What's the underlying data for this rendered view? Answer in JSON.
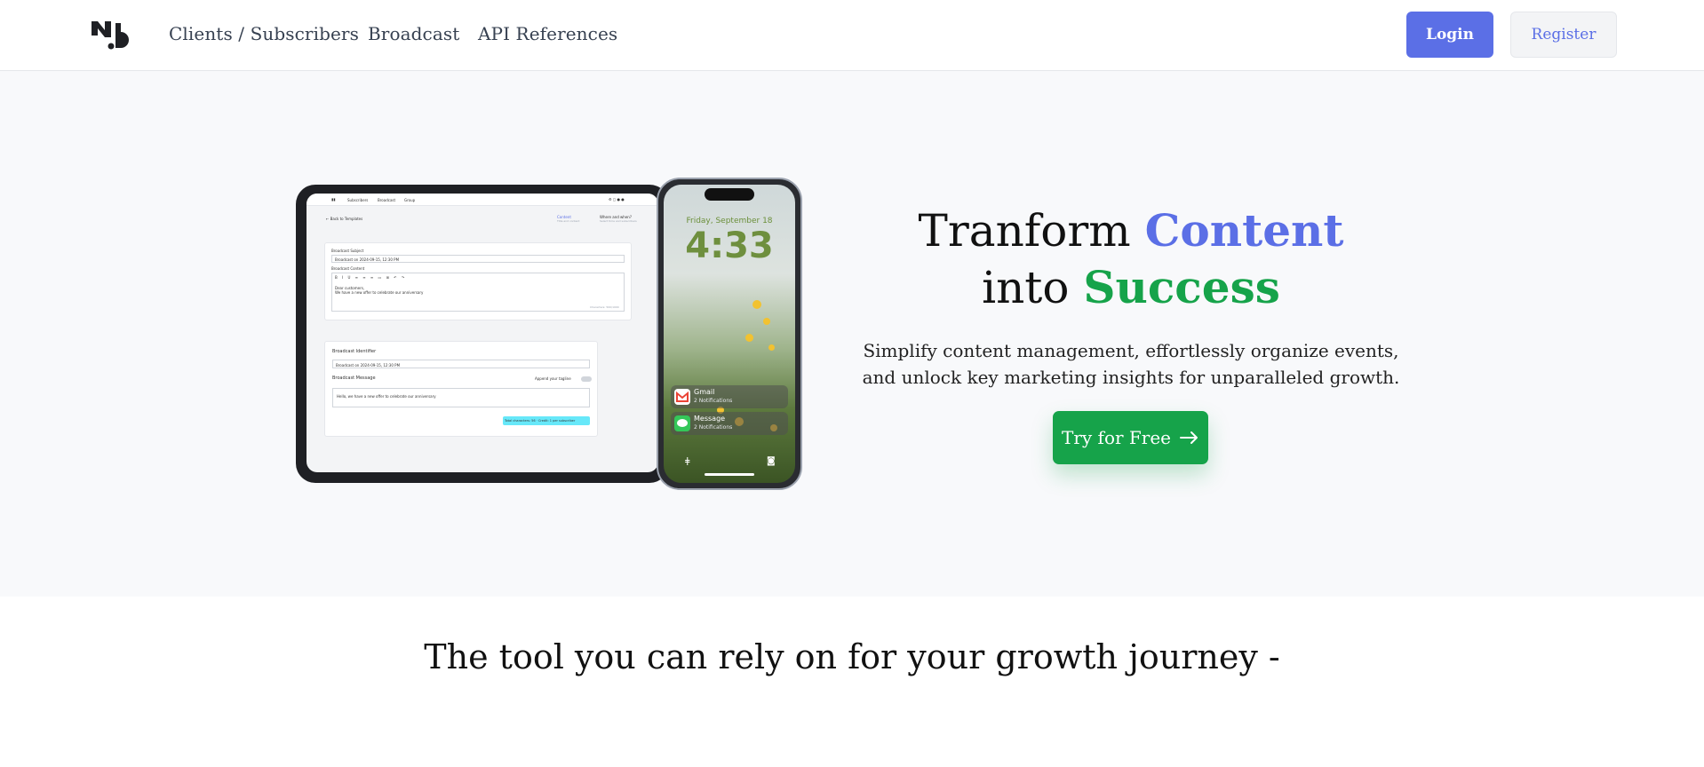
{
  "header": {
    "nav": [
      "Clients / Subscribers",
      "Broadcast",
      "API References"
    ],
    "login_label": "Login",
    "register_label": "Register"
  },
  "hero": {
    "headline_part1": "Tranform ",
    "headline_word1": "Content",
    "headline_part2": "into ",
    "headline_word2": "Success",
    "subtext_line1": "Simplify content management, effortlessly organize events,",
    "subtext_line2": "and unlock key marketing insights for unparalleled growth.",
    "cta_label": "Try for Free",
    "cta_icon": "arrow-right-icon"
  },
  "tablet": {
    "nav": [
      "Subscribers",
      "Broadcast",
      "Group"
    ],
    "back_link": "← Back to Templates",
    "step1": "Content",
    "step1_sub": "Title and content",
    "step2": "Where and when?",
    "step2_sub": "Select time and subscribers",
    "field1_label": "Broadcast Subject",
    "field1_value": "Broadcast on 2024-09-15, 12:30 PM",
    "field2_label": "Broadcast Content",
    "editor_text1": "Dear customers,",
    "editor_text2": "We have a new offer to celebrate our anniversary",
    "counter": "Characters: 500/1000",
    "card2_title": "Broadcast Identifier",
    "card2_value": "Broadcast on 2024-09-15, 12:30 PM",
    "card2_msg_label": "Broadcast Message",
    "card2_toggle_label": "Append your tagline",
    "card2_msg": "Hello, we have a new offer to celebrate our anniversary",
    "card2_badge": "Total characters: 56 · Credit: 1 per subscriber"
  },
  "phone": {
    "date": "Friday, September 18",
    "time": "4:33",
    "notifications": [
      {
        "title": "Gmail",
        "sub": "2 Notifications"
      },
      {
        "title": "Message",
        "sub": "2 Notifications"
      }
    ]
  },
  "tagline": "The tool you can rely on for your growth journey -",
  "colors": {
    "primary": "#5b6fe6",
    "success": "#16a34a",
    "hero_bg": "#f8f9fb"
  }
}
